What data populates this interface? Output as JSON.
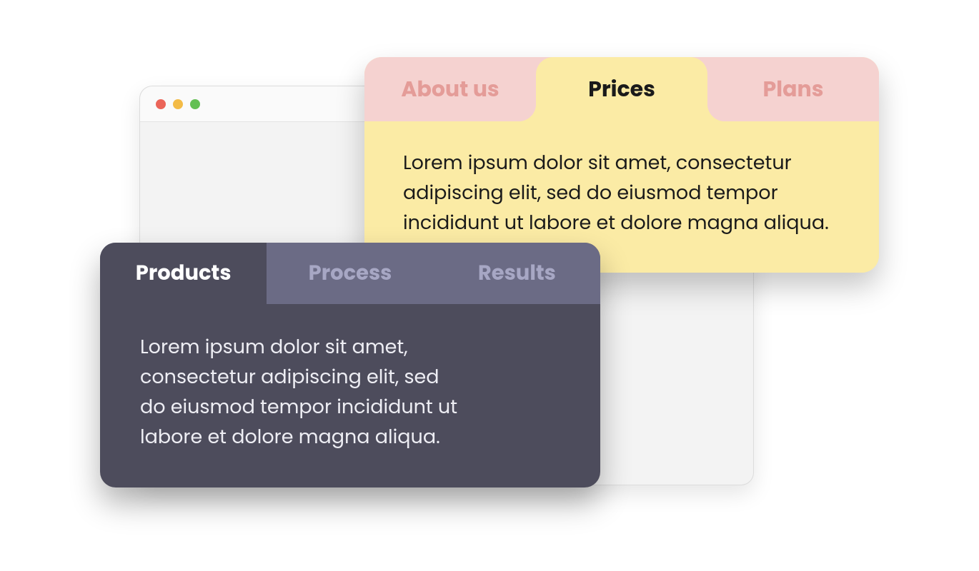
{
  "browser": {
    "traffic_lights": {
      "red": "#eb6559",
      "yellow": "#f3bb46",
      "green": "#63c054"
    }
  },
  "light_panel": {
    "tabs": [
      {
        "label": "About us",
        "active": false
      },
      {
        "label": "Prices",
        "active": true
      },
      {
        "label": "Plans",
        "active": false
      }
    ],
    "content": "Lorem ipsum dolor sit amet, consectetur adipiscing elit, sed do eiusmod tempor incididunt ut labore et dolore magna aliqua.",
    "colors": {
      "tab_bg": "#f5d2d0",
      "active_bg": "#fbeba5",
      "inactive_text": "#e49c98",
      "active_text": "#1a1a1a"
    }
  },
  "dark_panel": {
    "tabs": [
      {
        "label": "Products",
        "active": true
      },
      {
        "label": "Process",
        "active": false
      },
      {
        "label": "Results",
        "active": false
      }
    ],
    "content": "Lorem ipsum dolor sit amet, consectetur adipiscing elit, sed do eiusmod tempor incididunt ut labore et dolore magna aliqua.",
    "colors": {
      "tab_bg": "#6b6b85",
      "active_bg": "#4d4c5c",
      "inactive_text": "#a7a7c4",
      "active_text": "#ffffff"
    }
  }
}
